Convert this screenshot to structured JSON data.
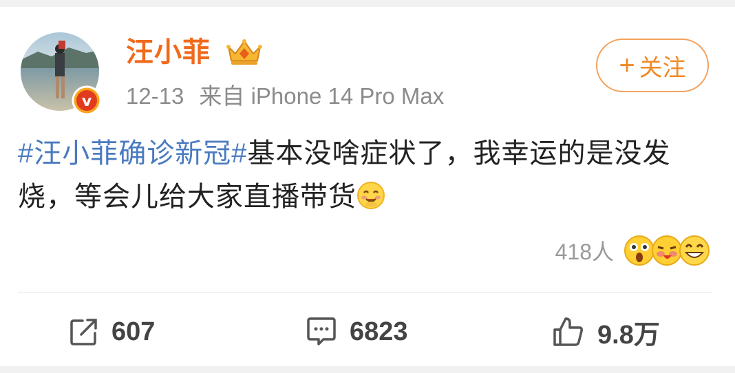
{
  "post": {
    "username": "汪小菲",
    "date": "12-13",
    "source": "来自 iPhone 14 Pro Max",
    "follow_label": "关注",
    "follow_plus": "+",
    "hashtag": "#汪小菲确诊新冠#",
    "text": "基本没啥症状了，我幸运的是没发烧，等会儿给大家直播带货"
  },
  "reactions": {
    "count": "418人",
    "icons": [
      "surprised-emoji-icon",
      "kiss-emoji-icon",
      "grin-emoji-icon"
    ]
  },
  "actions": {
    "repost_count": "607",
    "comment_count": "6823",
    "like_count": "9.8万"
  },
  "colors": {
    "username": "#f06a1b",
    "hashtag": "#4a7bbf",
    "follow_border": "#f4a05a",
    "meta_text": "#8b8b8b"
  }
}
